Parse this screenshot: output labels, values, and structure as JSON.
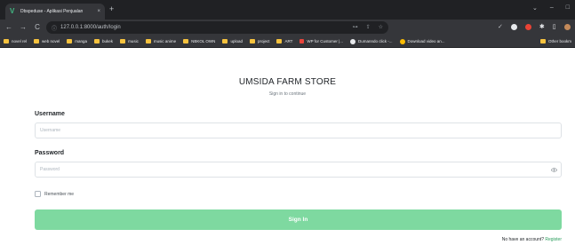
{
  "browser": {
    "tab_title": "Dbspeduse - Aplikasi Penjualan",
    "tab_close": "×",
    "new_tab": "+",
    "url": "127.0.0.1:8000/auth/login",
    "controls": {
      "minimize": "–",
      "maximize": "□"
    },
    "nav": {
      "back": "←",
      "forward": "→",
      "reload": "C"
    },
    "bookmarks": [
      "novel rel",
      "web novel",
      "manga",
      "bukek",
      "music",
      "music anime",
      "NBKOL OWN",
      "upload",
      "project",
      "ART",
      "WP for Customer |...",
      "Dumanndo click -...",
      "Download video an..."
    ],
    "other_bookmarks": "Other bookm"
  },
  "page": {
    "store_title": "UMSIDA FARM STORE",
    "subtitle": "Sign in to continue",
    "username_label": "Username",
    "username_placeholder": "Username",
    "password_label": "Password",
    "password_placeholder": "Password",
    "remember_label": "Remember me",
    "signin_label": "Sign In",
    "no_account_text": "No have an account?",
    "register_link": "Register"
  },
  "colors": {
    "signin_button": "#7ed9a0",
    "chrome_bg": "#202124",
    "bookmark_folder": "#f6c23e"
  }
}
